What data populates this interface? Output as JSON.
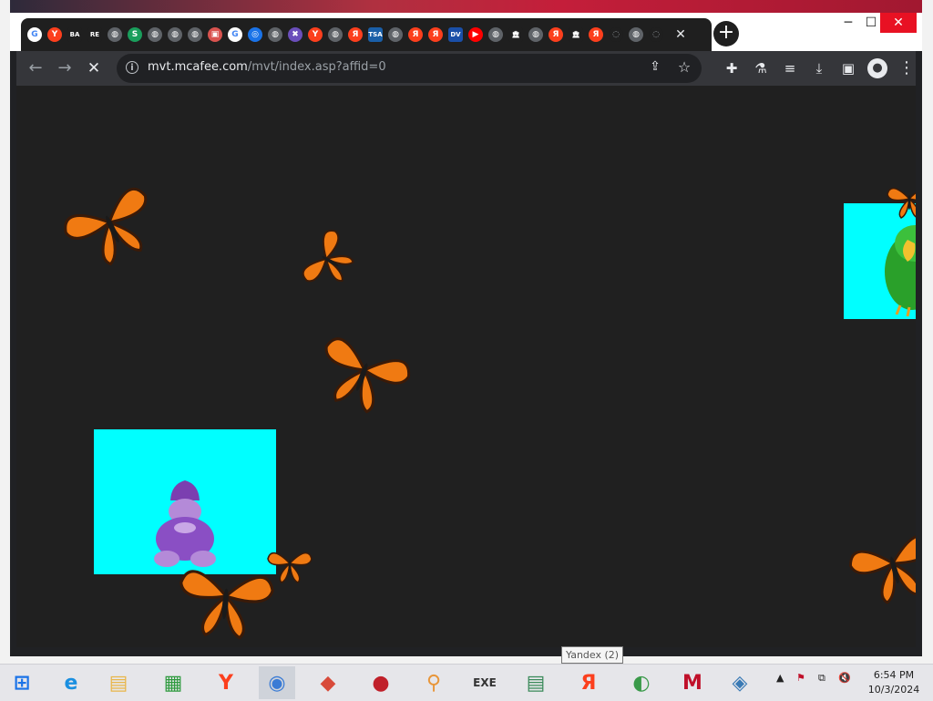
{
  "browser": {
    "tabs": [
      {
        "icon": "google-icon",
        "glyph": "G",
        "bg": "#ffffff",
        "fg": "#4285f4"
      },
      {
        "icon": "yandex-icon",
        "glyph": "Y",
        "bg": "#fc3f1d",
        "fg": "#ffffff"
      },
      {
        "icon": "ba-icon",
        "glyph": "BA",
        "bg": "#1f1f1f",
        "fg": "#ffffff"
      },
      {
        "icon": "re-icon",
        "glyph": "RE",
        "bg": "#1f1f1f",
        "fg": "#ffffff"
      },
      {
        "icon": "globe-icon",
        "glyph": "◍",
        "bg": "#5f6368",
        "fg": "#ffffff"
      },
      {
        "icon": "s-icon",
        "glyph": "S",
        "bg": "#1a9e5c",
        "fg": "#ffffff"
      },
      {
        "icon": "globe-icon",
        "glyph": "◍",
        "bg": "#5f6368",
        "fg": "#ffffff"
      },
      {
        "icon": "globe-icon",
        "glyph": "◍",
        "bg": "#5f6368",
        "fg": "#ffffff"
      },
      {
        "icon": "globe-icon",
        "glyph": "◍",
        "bg": "#5f6368",
        "fg": "#ffffff"
      },
      {
        "icon": "image-icon",
        "glyph": "▣",
        "bg": "#d9534f",
        "fg": "#ffffff"
      },
      {
        "icon": "google-icon",
        "glyph": "G",
        "bg": "#ffffff",
        "fg": "#4285f4"
      },
      {
        "icon": "target-icon",
        "glyph": "◎",
        "bg": "#1a73e8",
        "fg": "#ffffff"
      },
      {
        "icon": "globe-icon",
        "glyph": "◍",
        "bg": "#5f6368",
        "fg": "#ffffff"
      },
      {
        "icon": "purple-icon",
        "glyph": "✖",
        "bg": "#6b4fbb",
        "fg": "#ffffff"
      },
      {
        "icon": "yandex-icon",
        "glyph": "Y",
        "bg": "#fc3f1d",
        "fg": "#ffffff"
      },
      {
        "icon": "globe-icon",
        "glyph": "◍",
        "bg": "#5f6368",
        "fg": "#ffffff"
      },
      {
        "icon": "yandex-r-icon",
        "glyph": "Я",
        "bg": "#fc3f1d",
        "fg": "#ffffff"
      },
      {
        "icon": "tsa-icon",
        "glyph": "TSA",
        "bg": "#1a5fa8",
        "fg": "#ffffff"
      },
      {
        "icon": "globe-icon",
        "glyph": "◍",
        "bg": "#5f6368",
        "fg": "#ffffff"
      },
      {
        "icon": "yandex-r-icon",
        "glyph": "Я",
        "bg": "#fc3f1d",
        "fg": "#ffffff"
      },
      {
        "icon": "yandex-r-icon",
        "glyph": "Я",
        "bg": "#fc3f1d",
        "fg": "#ffffff"
      },
      {
        "icon": "dv-icon",
        "glyph": "DV",
        "bg": "#1a4fa8",
        "fg": "#ffffff"
      },
      {
        "icon": "youtube-icon",
        "glyph": "▶",
        "bg": "#ff0000",
        "fg": "#ffffff"
      },
      {
        "icon": "globe-icon",
        "glyph": "◍",
        "bg": "#5f6368",
        "fg": "#ffffff"
      },
      {
        "icon": "bank-icon",
        "glyph": "🏛",
        "bg": "#1f1f1f",
        "fg": "#ffffff"
      },
      {
        "icon": "globe-icon",
        "glyph": "◍",
        "bg": "#5f6368",
        "fg": "#ffffff"
      },
      {
        "icon": "yandex-r-icon",
        "glyph": "Я",
        "bg": "#fc3f1d",
        "fg": "#ffffff"
      },
      {
        "icon": "bank-icon",
        "glyph": "🏛",
        "bg": "#1f1f1f",
        "fg": "#ffffff"
      },
      {
        "icon": "yandex-r-icon",
        "glyph": "Я",
        "bg": "#fc3f1d",
        "fg": "#ffffff"
      },
      {
        "icon": "loading-icon",
        "glyph": "◌",
        "bg": "#1f1f1f",
        "fg": "#9aa0a6"
      },
      {
        "icon": "globe-icon",
        "glyph": "◍",
        "bg": "#5f6368",
        "fg": "#ffffff"
      },
      {
        "icon": "loading-icon",
        "glyph": "◌",
        "bg": "#1f1f1f",
        "fg": "#9aa0a6"
      }
    ],
    "tab_close": "✕",
    "new_tab": "+",
    "window": {
      "minimize": "─",
      "maximize": "☐",
      "close": "✕"
    },
    "nav": {
      "back": "←",
      "forward": "→",
      "stop": "✕"
    },
    "url": {
      "host": "mvt.mcafee.com",
      "path": "/mvt/index.asp?affid=0"
    },
    "toolbar_icons": {
      "share": "⇪",
      "star": "☆",
      "extensions": "✚",
      "lab": "⚗",
      "media": "≡",
      "download": "⤓",
      "sidepanel": "▣",
      "profile": "●",
      "menu": "⋮"
    }
  },
  "page": {
    "background": "#202020",
    "accent": "#00ffff",
    "sprites": [
      "butterfly",
      "butterfly",
      "butterfly",
      "parrot",
      "gnome",
      "butterfly",
      "butterfly"
    ]
  },
  "taskbar": {
    "apps": [
      {
        "name": "start-button",
        "glyph": "⊞",
        "color": "#1a73e8"
      },
      {
        "name": "internet-explorer-icon",
        "glyph": "e",
        "color": "#1a8fe0"
      },
      {
        "name": "file-explorer-icon",
        "glyph": "▤",
        "color": "#e8b64a"
      },
      {
        "name": "store-icon",
        "glyph": "▦",
        "color": "#2e9a3e"
      },
      {
        "name": "yandex-browser-icon",
        "glyph": "Y",
        "color": "#fc3f1d"
      },
      {
        "name": "chrome-icon",
        "glyph": "◉",
        "color": "#3a7bd5"
      },
      {
        "name": "package-icon",
        "glyph": "◆",
        "color": "#d84a3a"
      },
      {
        "name": "red-sphere-icon",
        "glyph": "●",
        "color": "#c0202a"
      },
      {
        "name": "magnifier-app-icon",
        "glyph": "⚲",
        "color": "#e8963a"
      },
      {
        "name": "youtube-exe-icon",
        "glyph": "EXE",
        "color": "#333333"
      },
      {
        "name": "document-icon",
        "glyph": "▤",
        "color": "#3a8a5a"
      },
      {
        "name": "yandex-icon",
        "glyph": "Я",
        "color": "#fc3f1d"
      },
      {
        "name": "download-manager-icon",
        "glyph": "◐",
        "color": "#3a9a4a"
      },
      {
        "name": "mcafee-icon",
        "glyph": "M",
        "color": "#c0102a"
      },
      {
        "name": "shield-icon",
        "glyph": "◈",
        "color": "#3a7ab5"
      }
    ],
    "tray": {
      "chevron": "▲",
      "flag": "⚑",
      "network": "⧉",
      "volume": "🔇"
    },
    "tooltip": "Yandex (2)",
    "clock": {
      "time": "6:54 PM",
      "date": "10/3/2024"
    }
  }
}
